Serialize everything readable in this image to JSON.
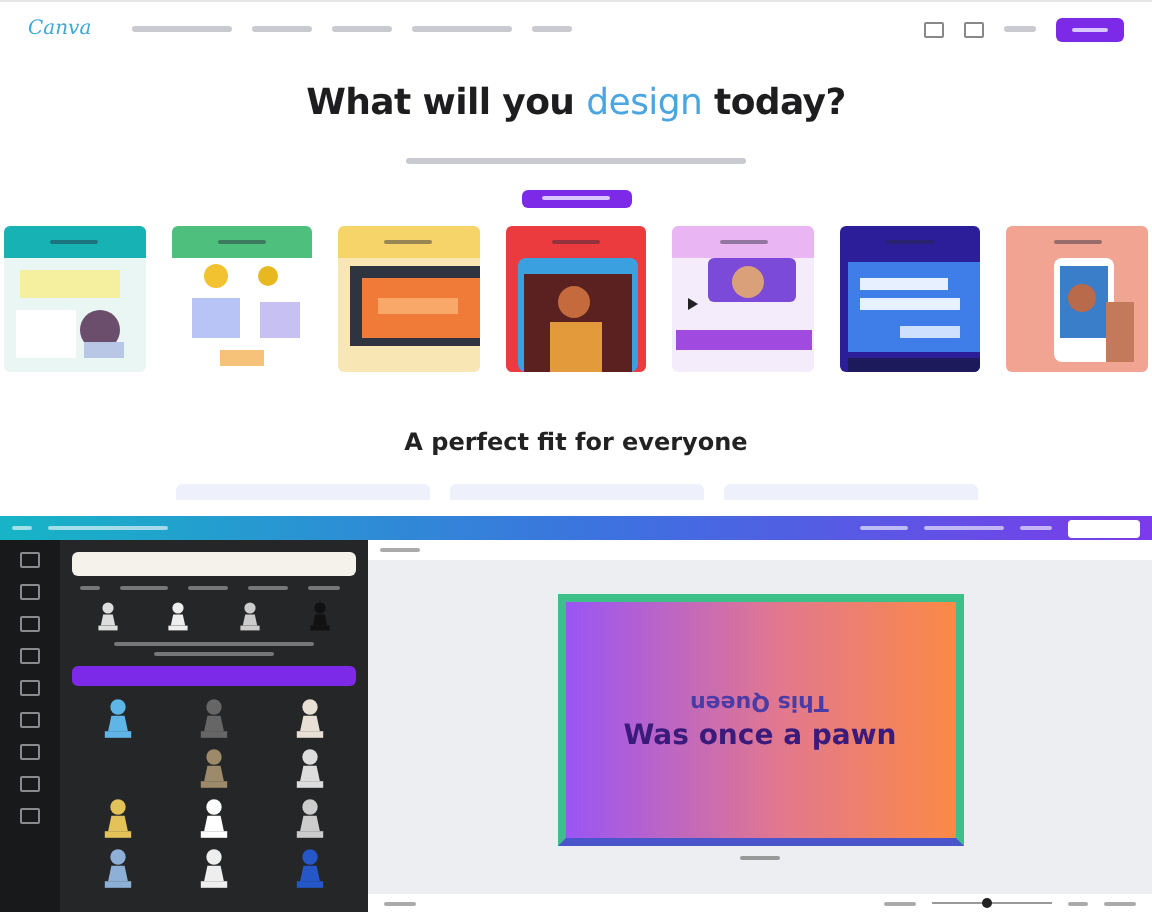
{
  "website": {
    "logo": "Canva",
    "headline": [
      {
        "text": "What will you ",
        "highlight": false
      },
      {
        "text": "design",
        "highlight": true
      },
      {
        "text": " today?",
        "highlight": false
      }
    ],
    "cards": [
      {
        "color": "#17b3b4"
      },
      {
        "color": "#4fbf7e"
      },
      {
        "color": "#f6d46a"
      },
      {
        "color": "#ec3b3f"
      },
      {
        "color": "#e9b5f2"
      },
      {
        "color": "#2b1e98"
      },
      {
        "color": "#f2a493"
      }
    ],
    "section_title": "A perfect fit for everyone"
  },
  "editor": {
    "zoom": {
      "level": 0.45
    },
    "design_lines": [
      {
        "text": "This Queen",
        "flipped": true
      },
      {
        "text": "Was once a pawn",
        "flipped": false
      }
    ]
  }
}
